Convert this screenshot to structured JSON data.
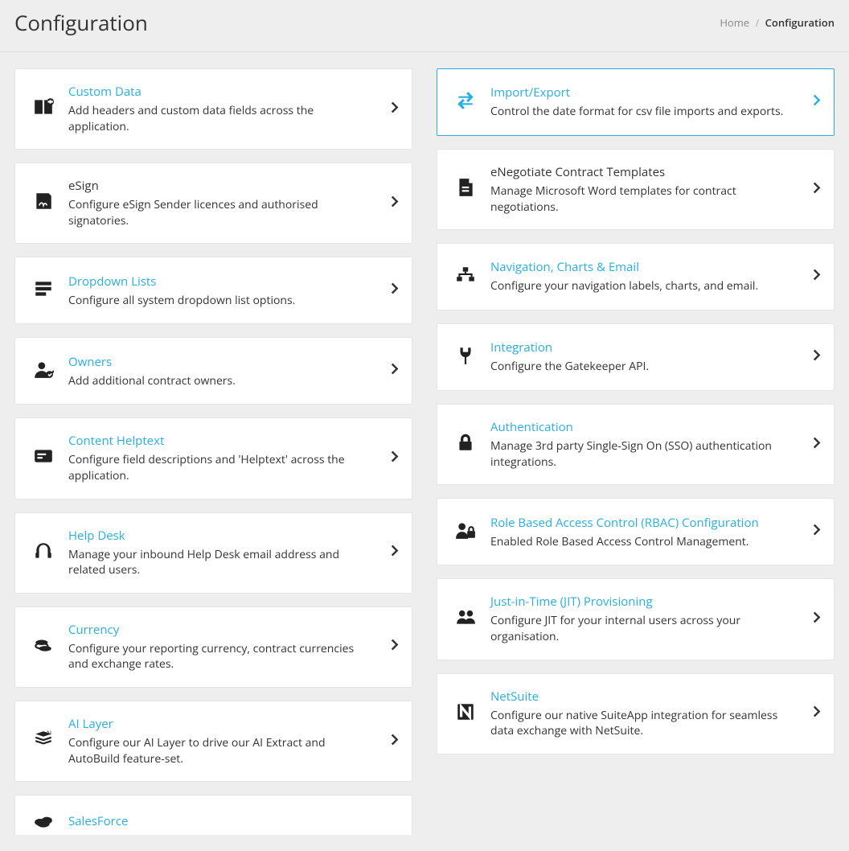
{
  "page": {
    "title": "Configuration"
  },
  "breadcrumb": {
    "home": "Home",
    "sep": "/",
    "current": "Configuration"
  },
  "left": [
    {
      "title": "Custom Data",
      "desc": "Add headers and custom data fields across the application.",
      "icon": "custom-data",
      "titleMode": "link"
    },
    {
      "title": "eSign",
      "desc": "Configure eSign Sender licences and authorised signatories.",
      "icon": "esign",
      "titleMode": "dark"
    },
    {
      "title": "Dropdown Lists",
      "desc": "Configure all system dropdown list options.",
      "icon": "dropdown",
      "titleMode": "link"
    },
    {
      "title": "Owners",
      "desc": "Add additional contract owners.",
      "icon": "owners",
      "titleMode": "link"
    },
    {
      "title": "Content Helptext",
      "desc": "Configure field descriptions and 'Helptext' across the application.",
      "icon": "helptext",
      "titleMode": "link"
    },
    {
      "title": "Help Desk",
      "desc": "Manage your inbound Help Desk email address and related users.",
      "icon": "helpdesk",
      "titleMode": "link"
    },
    {
      "title": "Currency",
      "desc": "Configure your reporting currency, contract currencies and exchange rates.",
      "icon": "currency",
      "titleMode": "link"
    },
    {
      "title": "AI Layer",
      "desc": "Configure our AI Layer to drive our AI Extract and AutoBuild feature-set.",
      "icon": "ai",
      "titleMode": "link"
    },
    {
      "title": "SalesForce",
      "desc": "",
      "icon": "salesforce",
      "titleMode": "link"
    }
  ],
  "right": [
    {
      "title": "Import/Export",
      "desc": "Control the date format for csv file imports and exports.",
      "icon": "import-export",
      "titleMode": "link",
      "selected": true
    },
    {
      "title": "eNegotiate Contract Templates",
      "desc": "Manage Microsoft Word templates for contract negotiations.",
      "icon": "enegotiate",
      "titleMode": "dark"
    },
    {
      "title": "Navigation, Charts & Email",
      "desc": "Configure your navigation labels, charts, and email.",
      "icon": "nav",
      "titleMode": "link"
    },
    {
      "title": "Integration",
      "desc": "Configure the Gatekeeper API.",
      "icon": "integration",
      "titleMode": "link"
    },
    {
      "title": "Authentication",
      "desc": "Manage 3rd party Single-Sign On (SSO) authentication integrations.",
      "icon": "auth",
      "titleMode": "link"
    },
    {
      "title": "Role Based Access Control (RBAC) Configuration",
      "desc": "Enabled Role Based Access Control Management.",
      "icon": "rbac",
      "titleMode": "link"
    },
    {
      "title": "Just-in-Time (JIT) Provisioning",
      "desc": "Configure JIT for your internal users across your organisation.",
      "icon": "jit",
      "titleMode": "link"
    },
    {
      "title": "NetSuite",
      "desc": "Configure our native SuiteApp integration for seamless data exchange with NetSuite.",
      "icon": "netsuite",
      "titleMode": "link"
    }
  ]
}
